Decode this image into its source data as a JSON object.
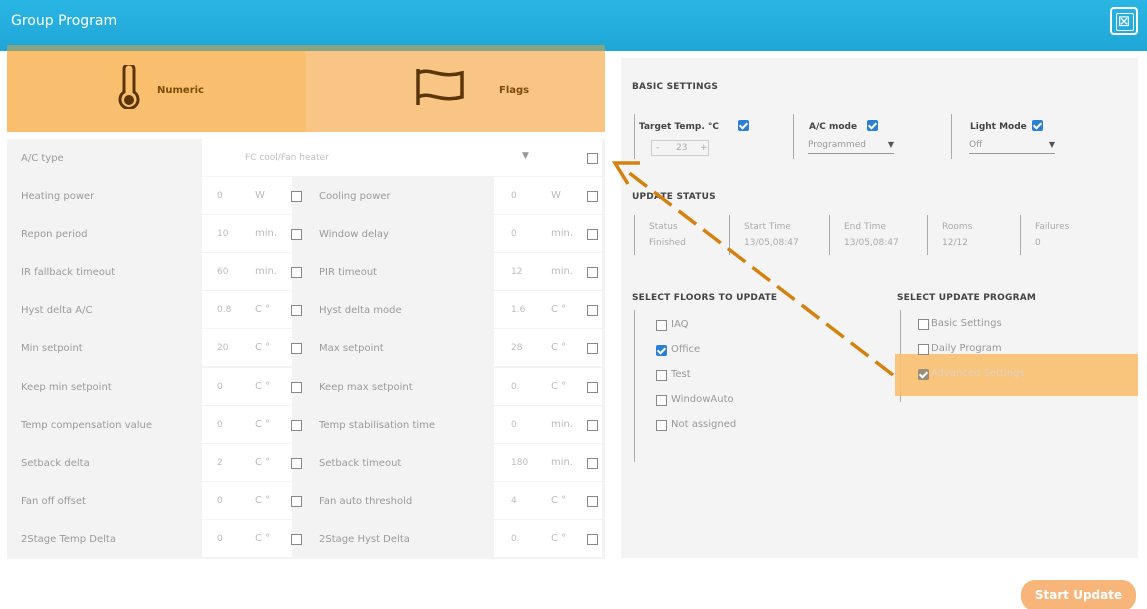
{
  "window": {
    "title": "Group Program",
    "close_symbol": "⊠"
  },
  "tabs": [
    {
      "label": "Numeric",
      "icon": "thermometer-icon"
    },
    {
      "label": "Flags",
      "icon": "flag-icon"
    }
  ],
  "grid": {
    "ac_type": {
      "label": "A/C type",
      "value": "FC cool/Fan heater"
    },
    "rows": [
      {
        "left": {
          "label": "Heating power",
          "value": "0",
          "unit": "W"
        },
        "right": {
          "label": "Cooling power",
          "value": "0",
          "unit": "W"
        }
      },
      {
        "left": {
          "label": "Repon period",
          "value": "10",
          "unit": "min."
        },
        "right": {
          "label": "Window delay",
          "value": "0",
          "unit": "min."
        }
      },
      {
        "left": {
          "label": "IR fallback timeout",
          "value": "60",
          "unit": "min."
        },
        "right": {
          "label": "PIR timeout",
          "value": "12",
          "unit": "min."
        }
      },
      {
        "left": {
          "label": "Hyst delta A/C",
          "value": "0.8",
          "unit": "C °"
        },
        "right": {
          "label": "Hyst delta mode",
          "value": "1.6",
          "unit": "C °"
        }
      },
      {
        "left": {
          "label": "Min setpoint",
          "value": "20",
          "unit": "C °"
        },
        "right": {
          "label": "Max setpoint",
          "value": "28",
          "unit": "C °"
        }
      },
      {
        "left": {
          "label": "Keep min setpoint",
          "value": "0",
          "unit": "C °"
        },
        "right": {
          "label": "Keep max setpoint",
          "value": "0",
          "unit": "C °"
        }
      },
      {
        "left": {
          "label": "Temp compensation value",
          "value": "0",
          "unit": "C °"
        },
        "right": {
          "label": "Temp stabilisation time",
          "value": "0",
          "unit": "min."
        }
      },
      {
        "left": {
          "label": "Setback delta",
          "value": "2",
          "unit": "C °"
        },
        "right": {
          "label": "Setback timeout",
          "value": "180",
          "unit": "min."
        }
      },
      {
        "left": {
          "label": "Fan off offset",
          "value": "0",
          "unit": "C °"
        },
        "right": {
          "label": "Fan auto threshold",
          "value": "4",
          "unit": "C °"
        }
      },
      {
        "left": {
          "label": "2Stage Temp Delta",
          "value": "0",
          "unit": "C °"
        },
        "right": {
          "label": "2Stage Hyst Delta",
          "value": "0",
          "unit": "C °"
        }
      }
    ]
  },
  "basic_settings": {
    "title": "BASIC SETTINGS",
    "target_temp": {
      "label": "Target Temp. °C",
      "minus": "-",
      "value": "23",
      "plus": "+"
    },
    "ac_mode": {
      "label": "A/C mode",
      "value": "Programmed"
    },
    "light_mode": {
      "label": "Light Mode",
      "value": "Off"
    }
  },
  "update_status": {
    "title": "UPDATE STATUS",
    "columns": [
      {
        "header": "Status",
        "value": "Finished"
      },
      {
        "header": "Start Time",
        "value": "13/05,08:47"
      },
      {
        "header": "End Time",
        "value": "13/05,08:47"
      },
      {
        "header": "Rooms",
        "value": "12/12"
      },
      {
        "header": "Failures",
        "value": "0"
      }
    ]
  },
  "floors": {
    "title": "SELECT FLOORS TO UPDATE",
    "items": [
      {
        "label": "IAQ",
        "checked": false
      },
      {
        "label": "Office",
        "checked": true
      },
      {
        "label": "Test",
        "checked": false
      },
      {
        "label": "WindowAuto",
        "checked": false
      },
      {
        "label": "Not assigned",
        "checked": false
      }
    ]
  },
  "programs": {
    "title": "SELECT UPDATE PROGRAM",
    "items": [
      {
        "label": "Basic Settings",
        "checked": false
      },
      {
        "label": "Daily Program",
        "checked": false
      },
      {
        "label": "Advanced Settings",
        "checked": true
      }
    ]
  },
  "footer": {
    "start_label": "Start Update"
  },
  "colors": {
    "titlebar": "#1ea5d6",
    "accent_orange": "#f9bf6f",
    "button": "#f8b57a",
    "arrow": "#d3820f"
  }
}
